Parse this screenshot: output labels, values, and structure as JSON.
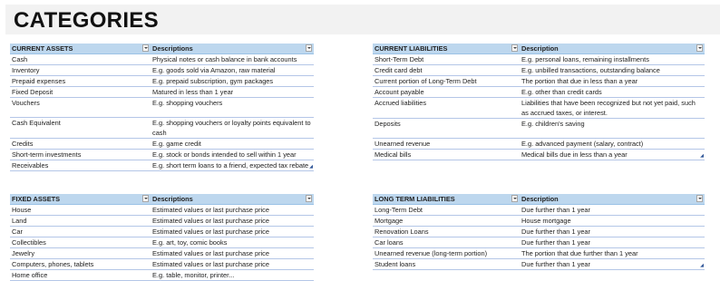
{
  "page": {
    "title": "CATEGORIES"
  },
  "current_assets": {
    "headers": [
      "CURRENT ASSETS",
      "Descriptions"
    ],
    "rows": [
      [
        "Cash",
        "Physical notes or cash balance in bank accounts"
      ],
      [
        "Inventory",
        "E.g. goods sold via Amazon, raw material"
      ],
      [
        "Prepaid expenses",
        "E.g. prepaid subscription, gym packages"
      ],
      [
        "Fixed Deposit",
        "Matured in less than 1 year"
      ],
      [
        "Vouchers",
        "E.g. shopping vouchers"
      ],
      [
        "Cash Equivalent",
        "E.g. shopping vouchers or loyalty points equivalent to cash"
      ],
      [
        "Credits",
        "E.g. game credit"
      ],
      [
        "Short-term investments",
        "E.g. stock or bonds intended to sell within 1 year"
      ],
      [
        "Receivables",
        "E.g. short term loans to a friend, expected tax rebate"
      ]
    ]
  },
  "current_liabilities": {
    "headers": [
      "CURRENT LIABILITIES",
      "Description"
    ],
    "rows": [
      [
        "Short-Term Debt",
        "E.g. personal loans, remaining installments"
      ],
      [
        "Credit card debt",
        "E.g. unbilled transactions, outstanding balance"
      ],
      [
        "Current portion of Long-Term Debt",
        "The portion that due in less than a year"
      ],
      [
        "Account payable",
        "E.g. other than credit cards"
      ],
      [
        "Accrued liabilities",
        "Liabilities that have been recognized but not yet paid, such as accrued taxes, or interest."
      ],
      [
        "Deposits",
        "E.g. children's saving"
      ],
      [
        "Unearned revenue",
        "E.g. advanced payment (salary, contract)"
      ],
      [
        "Medical bills",
        "Medical bills due in less than a year"
      ]
    ]
  },
  "fixed_assets": {
    "headers": [
      "FIXED ASSETS",
      "Descriptions"
    ],
    "rows": [
      [
        "House",
        "Estimated values or last purchase price"
      ],
      [
        "Land",
        "Estimated values or last purchase price"
      ],
      [
        "Car",
        "Estimated values or last purchase price"
      ],
      [
        "Collectibles",
        "E.g. art, toy, comic books"
      ],
      [
        "Jewelry",
        "Estimated values or last purchase price"
      ],
      [
        "Computers, phones, tablets",
        "Estimated values or last purchase price"
      ],
      [
        "Home office",
        "E.g. table, monitor, printer..."
      ]
    ]
  },
  "long_term_liabilities": {
    "headers": [
      "LONG TERM LIABILITIES",
      "Description"
    ],
    "rows": [
      [
        "Long-Term Debt",
        "Due further than 1 year"
      ],
      [
        "Mortgage",
        "House mortgage"
      ],
      [
        "Renovation Loans",
        "Due further than 1 year"
      ],
      [
        "Car loans",
        "Due further than 1 year"
      ],
      [
        "Unearned revenue (long-term portion)",
        "The portion that due further than 1 year"
      ],
      [
        "Student loans",
        "Due further than 1 year"
      ]
    ]
  }
}
